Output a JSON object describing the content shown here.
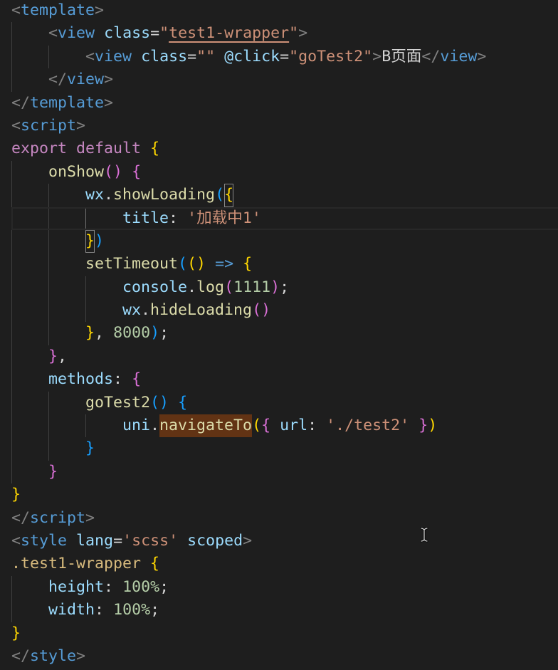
{
  "editor": {
    "colors": {
      "background": "#1e1e1e",
      "punct": "#808080",
      "tag": "#569cd6",
      "attr": "#9cdcfe",
      "op": "#d4d4d4",
      "str": "#ce9178",
      "text": "#d4d4d4",
      "kw": "#c586c0",
      "fn": "#dcdcaa",
      "var": "#9cdcfe",
      "num": "#b5cea8",
      "arrow": "#569cd6",
      "sel": "#d7ba7d",
      "b1": "#ffd700",
      "b2": "#da70d6",
      "b3": "#179fff",
      "ws": "#d4d4d4",
      "indent_guide": "#404040",
      "indent_guide_active": "#707070",
      "line_highlight_border": "#282828",
      "find_match_background": "#623314",
      "bracket_match_border": "#888888"
    },
    "lines": [
      {
        "tokens": [
          {
            "text": "<",
            "kind": "punct"
          },
          {
            "text": "template",
            "kind": "tag"
          },
          {
            "text": ">",
            "kind": "punct"
          }
        ]
      },
      {
        "tokens": [
          {
            "text": "    ",
            "kind": "ws"
          },
          {
            "text": "<",
            "kind": "punct"
          },
          {
            "text": "view",
            "kind": "tag"
          },
          {
            "text": " ",
            "kind": "ws"
          },
          {
            "text": "class",
            "kind": "attr"
          },
          {
            "text": "=",
            "kind": "op"
          },
          {
            "text": "\"",
            "kind": "str"
          },
          {
            "text": "test1-wrapper",
            "kind": "str",
            "underline": true
          },
          {
            "text": "\"",
            "kind": "str"
          },
          {
            "text": ">",
            "kind": "punct"
          }
        ]
      },
      {
        "tokens": [
          {
            "text": "        ",
            "kind": "ws"
          },
          {
            "text": "<",
            "kind": "punct"
          },
          {
            "text": "view",
            "kind": "tag"
          },
          {
            "text": " ",
            "kind": "ws"
          },
          {
            "text": "class",
            "kind": "attr"
          },
          {
            "text": "=",
            "kind": "op"
          },
          {
            "text": "\"\"",
            "kind": "str"
          },
          {
            "text": " ",
            "kind": "ws"
          },
          {
            "text": "@click",
            "kind": "attr"
          },
          {
            "text": "=",
            "kind": "op"
          },
          {
            "text": "\"goTest2\"",
            "kind": "str"
          },
          {
            "text": ">",
            "kind": "punct"
          },
          {
            "text": "B页面",
            "kind": "text"
          },
          {
            "text": "</",
            "kind": "punct"
          },
          {
            "text": "view",
            "kind": "tag"
          },
          {
            "text": ">",
            "kind": "punct"
          }
        ]
      },
      {
        "tokens": [
          {
            "text": "    ",
            "kind": "ws"
          },
          {
            "text": "</",
            "kind": "punct"
          },
          {
            "text": "view",
            "kind": "tag"
          },
          {
            "text": ">",
            "kind": "punct"
          }
        ]
      },
      {
        "tokens": [
          {
            "text": "</",
            "kind": "punct"
          },
          {
            "text": "template",
            "kind": "tag"
          },
          {
            "text": ">",
            "kind": "punct"
          }
        ]
      },
      {
        "tokens": [
          {
            "text": "<",
            "kind": "punct"
          },
          {
            "text": "script",
            "kind": "tag"
          },
          {
            "text": ">",
            "kind": "punct"
          }
        ]
      },
      {
        "tokens": [
          {
            "text": "export",
            "kind": "kw"
          },
          {
            "text": " ",
            "kind": "ws"
          },
          {
            "text": "default",
            "kind": "kw"
          },
          {
            "text": " ",
            "kind": "ws"
          },
          {
            "text": "{",
            "kind": "b1"
          }
        ]
      },
      {
        "tokens": [
          {
            "text": "    ",
            "kind": "ws"
          },
          {
            "text": "onShow",
            "kind": "fn"
          },
          {
            "text": "()",
            "kind": "b2"
          },
          {
            "text": " ",
            "kind": "ws"
          },
          {
            "text": "{",
            "kind": "b2"
          }
        ]
      },
      {
        "tokens": [
          {
            "text": "        ",
            "kind": "ws"
          },
          {
            "text": "wx",
            "kind": "var"
          },
          {
            "text": ".",
            "kind": "op"
          },
          {
            "text": "showLoading",
            "kind": "fn"
          },
          {
            "text": "(",
            "kind": "b3"
          },
          {
            "text": "{",
            "kind": "b1",
            "match": true
          }
        ]
      },
      {
        "current": true,
        "tokens": [
          {
            "text": "            ",
            "kind": "ws"
          },
          {
            "text": "title",
            "kind": "var"
          },
          {
            "text": ":",
            "kind": "op"
          },
          {
            "text": " ",
            "kind": "ws"
          },
          {
            "text": "'加载中1'",
            "kind": "str"
          }
        ]
      },
      {
        "tokens": [
          {
            "text": "        ",
            "kind": "ws"
          },
          {
            "text": "}",
            "kind": "b1",
            "match": true
          },
          {
            "text": ")",
            "kind": "b3"
          }
        ]
      },
      {
        "tokens": [
          {
            "text": "        ",
            "kind": "ws"
          },
          {
            "text": "setTimeout",
            "kind": "fn"
          },
          {
            "text": "(",
            "kind": "b3"
          },
          {
            "text": "()",
            "kind": "b1"
          },
          {
            "text": " ",
            "kind": "ws"
          },
          {
            "text": "=>",
            "kind": "arrow"
          },
          {
            "text": " ",
            "kind": "ws"
          },
          {
            "text": "{",
            "kind": "b1"
          }
        ]
      },
      {
        "tokens": [
          {
            "text": "            ",
            "kind": "ws"
          },
          {
            "text": "console",
            "kind": "var"
          },
          {
            "text": ".",
            "kind": "op"
          },
          {
            "text": "log",
            "kind": "fn"
          },
          {
            "text": "(",
            "kind": "b2"
          },
          {
            "text": "1111",
            "kind": "num"
          },
          {
            "text": ")",
            "kind": "b2"
          },
          {
            "text": ";",
            "kind": "op"
          }
        ]
      },
      {
        "tokens": [
          {
            "text": "            ",
            "kind": "ws"
          },
          {
            "text": "wx",
            "kind": "var"
          },
          {
            "text": ".",
            "kind": "op"
          },
          {
            "text": "hideLoading",
            "kind": "fn"
          },
          {
            "text": "()",
            "kind": "b2"
          }
        ]
      },
      {
        "tokens": [
          {
            "text": "        ",
            "kind": "ws"
          },
          {
            "text": "}",
            "kind": "b1"
          },
          {
            "text": ",",
            "kind": "op"
          },
          {
            "text": " ",
            "kind": "ws"
          },
          {
            "text": "8000",
            "kind": "num"
          },
          {
            "text": ")",
            "kind": "b3"
          },
          {
            "text": ";",
            "kind": "op"
          }
        ]
      },
      {
        "tokens": [
          {
            "text": "    ",
            "kind": "ws"
          },
          {
            "text": "}",
            "kind": "b2"
          },
          {
            "text": ",",
            "kind": "op"
          }
        ]
      },
      {
        "tokens": [
          {
            "text": "    ",
            "kind": "ws"
          },
          {
            "text": "methods",
            "kind": "var"
          },
          {
            "text": ":",
            "kind": "op"
          },
          {
            "text": " ",
            "kind": "ws"
          },
          {
            "text": "{",
            "kind": "b2"
          }
        ]
      },
      {
        "tokens": [
          {
            "text": "        ",
            "kind": "ws"
          },
          {
            "text": "goTest2",
            "kind": "fn"
          },
          {
            "text": "()",
            "kind": "b3"
          },
          {
            "text": " ",
            "kind": "ws"
          },
          {
            "text": "{",
            "kind": "b3"
          }
        ]
      },
      {
        "tokens": [
          {
            "text": "            ",
            "kind": "ws"
          },
          {
            "text": "uni",
            "kind": "var"
          },
          {
            "text": ".",
            "kind": "op"
          },
          {
            "text": "navigateTo",
            "kind": "fn",
            "find_match": true
          },
          {
            "text": "(",
            "kind": "b1"
          },
          {
            "text": "{",
            "kind": "b2"
          },
          {
            "text": " ",
            "kind": "ws"
          },
          {
            "text": "url",
            "kind": "var"
          },
          {
            "text": ":",
            "kind": "op"
          },
          {
            "text": " ",
            "kind": "ws"
          },
          {
            "text": "'./test2'",
            "kind": "str"
          },
          {
            "text": " ",
            "kind": "ws"
          },
          {
            "text": "}",
            "kind": "b2"
          },
          {
            "text": ")",
            "kind": "b1"
          }
        ]
      },
      {
        "tokens": [
          {
            "text": "        ",
            "kind": "ws"
          },
          {
            "text": "}",
            "kind": "b3"
          }
        ]
      },
      {
        "tokens": [
          {
            "text": "    ",
            "kind": "ws"
          },
          {
            "text": "}",
            "kind": "b2"
          }
        ]
      },
      {
        "tokens": [
          {
            "text": "}",
            "kind": "b1"
          }
        ]
      },
      {
        "tokens": [
          {
            "text": "</",
            "kind": "punct"
          },
          {
            "text": "script",
            "kind": "tag"
          },
          {
            "text": ">",
            "kind": "punct"
          }
        ]
      },
      {
        "tokens": [
          {
            "text": "<",
            "kind": "punct"
          },
          {
            "text": "style",
            "kind": "tag"
          },
          {
            "text": " ",
            "kind": "ws"
          },
          {
            "text": "lang",
            "kind": "attr"
          },
          {
            "text": "=",
            "kind": "op"
          },
          {
            "text": "'scss'",
            "kind": "str"
          },
          {
            "text": " ",
            "kind": "ws"
          },
          {
            "text": "scoped",
            "kind": "attr"
          },
          {
            "text": ">",
            "kind": "punct"
          }
        ]
      },
      {
        "tokens": [
          {
            "text": ".test1-wrapper",
            "kind": "sel"
          },
          {
            "text": " ",
            "kind": "ws"
          },
          {
            "text": "{",
            "kind": "b1"
          }
        ]
      },
      {
        "tokens": [
          {
            "text": "    ",
            "kind": "ws"
          },
          {
            "text": "height",
            "kind": "var"
          },
          {
            "text": ":",
            "kind": "op"
          },
          {
            "text": " ",
            "kind": "ws"
          },
          {
            "text": "100%",
            "kind": "num"
          },
          {
            "text": ";",
            "kind": "op"
          }
        ]
      },
      {
        "tokens": [
          {
            "text": "    ",
            "kind": "ws"
          },
          {
            "text": "width",
            "kind": "var"
          },
          {
            "text": ":",
            "kind": "op"
          },
          {
            "text": " ",
            "kind": "ws"
          },
          {
            "text": "100%",
            "kind": "num"
          },
          {
            "text": ";",
            "kind": "op"
          }
        ]
      },
      {
        "tokens": [
          {
            "text": "}",
            "kind": "b1"
          }
        ]
      },
      {
        "tokens": [
          {
            "text": "</",
            "kind": "punct"
          },
          {
            "text": "style",
            "kind": "tag"
          },
          {
            "text": ">",
            "kind": "punct"
          }
        ]
      }
    ]
  }
}
